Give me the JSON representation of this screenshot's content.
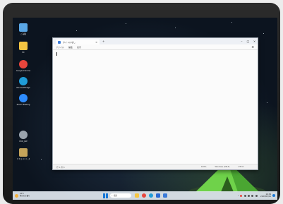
{
  "desktop": {
    "icons": [
      {
        "name": "recycle-bin",
        "label": "ごみ箱",
        "color": "#5aa7e6"
      },
      {
        "name": "folder",
        "label": "PC",
        "color": "#f5c542"
      },
      {
        "name": "chrome",
        "label": "Google Chrome",
        "color": "#e8453c"
      },
      {
        "name": "edge",
        "label": "Microsoft Edge",
        "color": "#1f9cd8"
      },
      {
        "name": "app",
        "label": "Zoom Meeting",
        "color": "#2d8cff"
      },
      {
        "name": "disk",
        "label": "DVD_RW",
        "color": "#9aa4ae"
      },
      {
        "name": "document",
        "label": "ドキュメント_2",
        "color": "#c4a35a"
      }
    ]
  },
  "notepad": {
    "tab_title": "タイトルなし",
    "menu": [
      "ファイル",
      "編集",
      "表示"
    ],
    "status": {
      "position": "行 1, 列 1",
      "zoom": "100%",
      "line_ending": "Windows (CRLF)",
      "encoding": "UTF-8"
    }
  },
  "taskbar": {
    "weather_temp": "18°C",
    "weather_desc": "晴れのち曇り",
    "search_placeholder": "検索",
    "apps": [
      {
        "name": "file-explorer",
        "color": "#f5c542"
      },
      {
        "name": "chrome",
        "color": "#e8453c"
      },
      {
        "name": "edge",
        "color": "#1f9cd8"
      },
      {
        "name": "store",
        "color": "#2a6ad4"
      },
      {
        "name": "notepad",
        "color": "#3b7bd8"
      }
    ],
    "time": "16:34",
    "date": "2023/05/21"
  }
}
